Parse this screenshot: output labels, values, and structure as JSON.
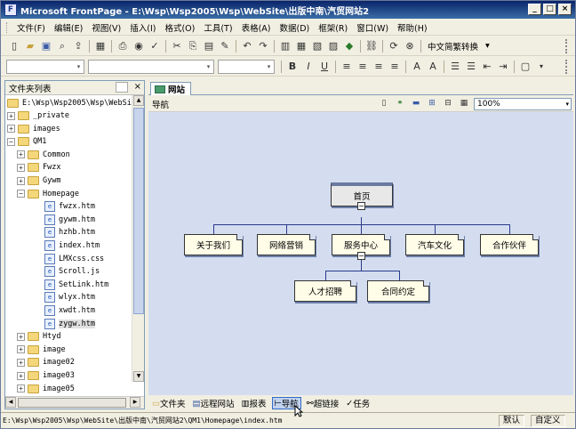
{
  "window": {
    "title": "Microsoft FrontPage - E:\\Wsp\\Wsp2005\\Wsp\\WebSite\\出版中南\\汽贸网站2",
    "buttons": [
      "_",
      "□",
      "×"
    ]
  },
  "menubar": {
    "items": [
      "文件(F)",
      "编辑(E)",
      "视图(V)",
      "插入(I)",
      "格式(O)",
      "工具(T)",
      "表格(A)",
      "数据(D)",
      "框架(R)",
      "窗口(W)",
      "帮助(H)"
    ]
  },
  "toolbar": {
    "convert_label": "中文简繁转换"
  },
  "format_toolbar": {
    "bold": "B",
    "italic": "I",
    "underline": "U"
  },
  "folder_pane": {
    "title": "文件夹列表",
    "root": "E:\\Wsp\\Wsp2005\\Wsp\\WebSi",
    "items": [
      {
        "label": "_private",
        "level": 1,
        "type": "folder",
        "exp": "+"
      },
      {
        "label": "images",
        "level": 1,
        "type": "folder",
        "exp": "+"
      },
      {
        "label": "QM1",
        "level": 1,
        "type": "folder",
        "exp": "−"
      },
      {
        "label": "Common",
        "level": 2,
        "type": "folder",
        "exp": "+"
      },
      {
        "label": "Fwzx",
        "level": 2,
        "type": "folder",
        "exp": "+"
      },
      {
        "label": "Gywm",
        "level": 2,
        "type": "folder",
        "exp": "+"
      },
      {
        "label": "Homepage",
        "level": 2,
        "type": "folder",
        "exp": "−"
      },
      {
        "label": "fwzx.htm",
        "level": 3,
        "type": "file"
      },
      {
        "label": "gywm.htm",
        "level": 3,
        "type": "file"
      },
      {
        "label": "hzhb.htm",
        "level": 3,
        "type": "file"
      },
      {
        "label": "index.htm",
        "level": 3,
        "type": "file"
      },
      {
        "label": "LMXcss.css",
        "level": 3,
        "type": "file"
      },
      {
        "label": "Scroll.js",
        "level": 3,
        "type": "file"
      },
      {
        "label": "SetLink.htm",
        "level": 3,
        "type": "file"
      },
      {
        "label": "wlyx.htm",
        "level": 3,
        "type": "file"
      },
      {
        "label": "xwdt.htm",
        "level": 3,
        "type": "file"
      },
      {
        "label": "zygw.htm",
        "level": 3,
        "type": "file"
      },
      {
        "label": "Htyd",
        "level": 2,
        "type": "folder",
        "exp": "+"
      },
      {
        "label": "image",
        "level": 2,
        "type": "folder",
        "exp": "+"
      },
      {
        "label": "image02",
        "level": 2,
        "type": "folder",
        "exp": "+"
      },
      {
        "label": "image03",
        "level": 2,
        "type": "folder",
        "exp": "+"
      },
      {
        "label": "image05",
        "level": 2,
        "type": "folder",
        "exp": "+"
      }
    ]
  },
  "main": {
    "tab_label": "网站",
    "nav_label": "导航",
    "zoom": "100%",
    "nodes": {
      "home": "首页",
      "about": "关于我们",
      "marketing": "网络营销",
      "service": "服务中心",
      "culture": "汽车文化",
      "partner": "合作伙伴",
      "recruit": "人才招聘",
      "contract": "合同约定"
    }
  },
  "views": [
    "文件夹",
    "远程网站",
    "报表",
    "导航",
    "超链接",
    "任务"
  ],
  "status": {
    "path": "E:\\Wsp\\Wsp2005\\Wsp\\WebSite\\出版中南\\汽贸网站2\\QM1\\Homepage\\index.htm",
    "default": "默认",
    "custom": "自定义"
  }
}
